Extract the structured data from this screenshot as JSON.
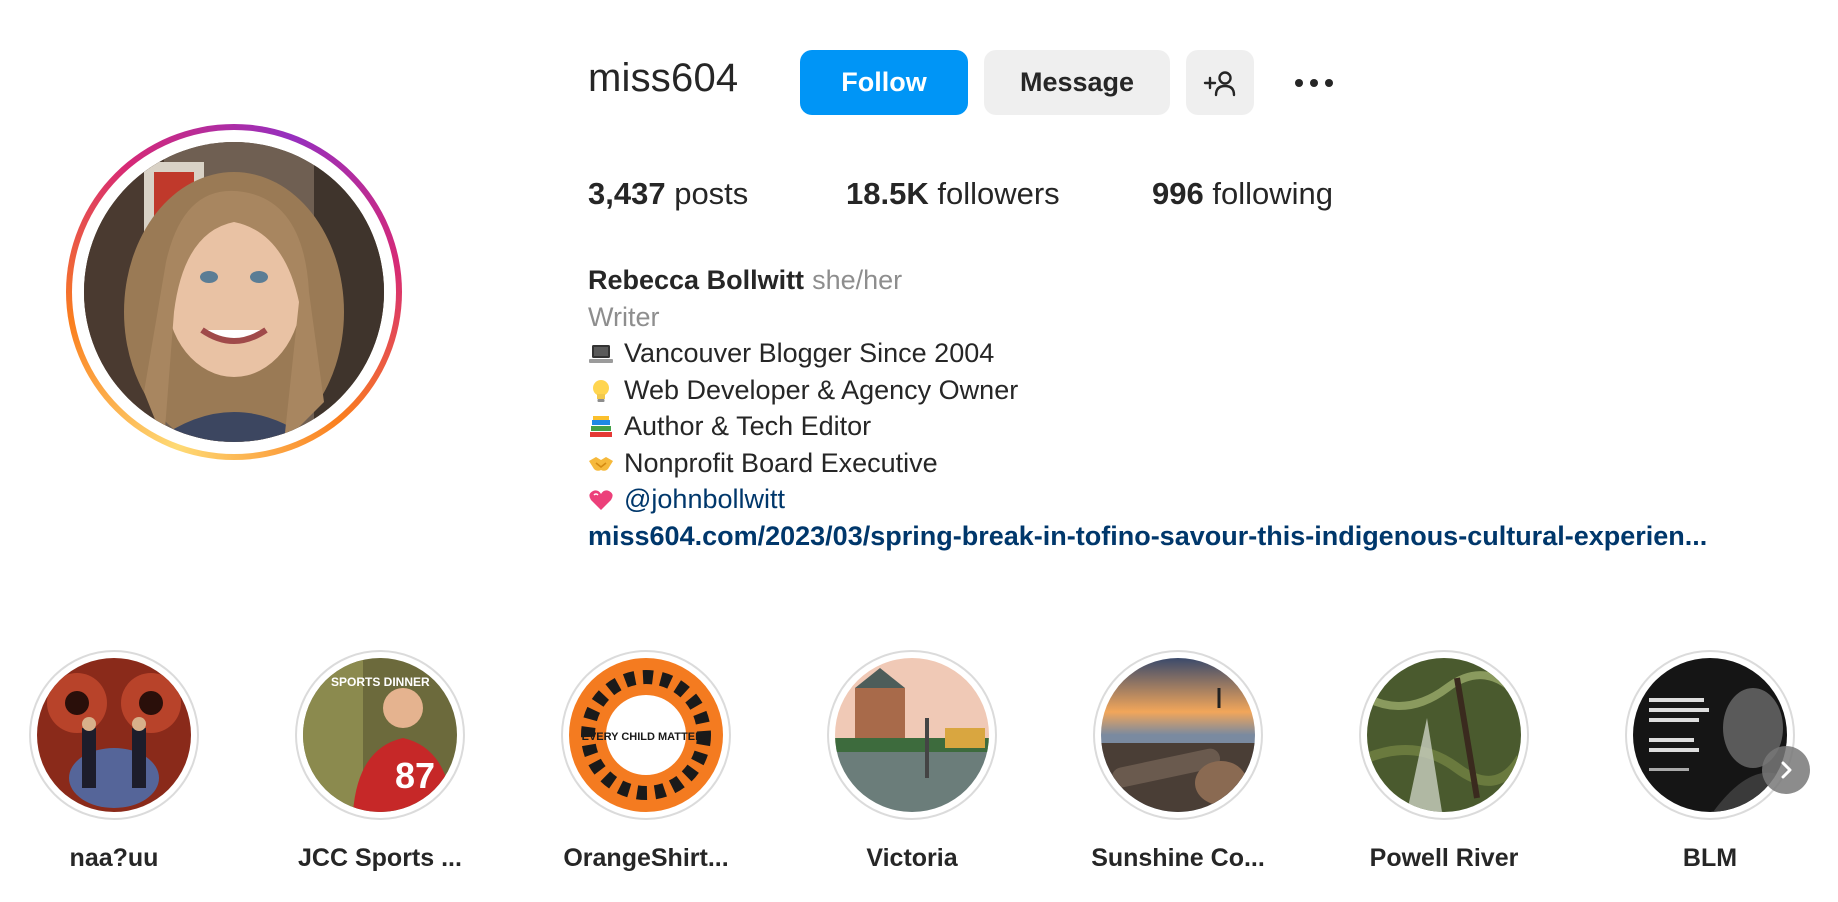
{
  "profile": {
    "username": "miss604",
    "follow_label": "Follow",
    "message_label": "Message",
    "stats": {
      "posts_count": "3,437",
      "posts_label": "posts",
      "followers_count": "18.5K",
      "followers_label": "followers",
      "following_count": "996",
      "following_label": "following"
    }
  },
  "bio": {
    "name": "Rebecca Bollwitt",
    "pronouns": "she/her",
    "category": "Writer",
    "lines": [
      {
        "icon": "laptop-icon",
        "text": "Vancouver Blogger Since 2004"
      },
      {
        "icon": "lightbulb-icon",
        "text": "Web Developer & Agency Owner"
      },
      {
        "icon": "books-icon",
        "text": "Author & Tech Editor"
      },
      {
        "icon": "handshake-icon",
        "text": "Nonprofit Board Executive"
      },
      {
        "icon": "heart-icon",
        "text": "@johnbollwitt"
      }
    ],
    "link": "miss604.com/2023/03/spring-break-in-tofino-savour-this-indigenous-cultural-experien..."
  },
  "highlights": [
    {
      "label": "naa?uu"
    },
    {
      "label": "JCC Sports ..."
    },
    {
      "label": "OrangeShirt..."
    },
    {
      "label": "Victoria"
    },
    {
      "label": "Sunshine Co..."
    },
    {
      "label": "Powell River"
    },
    {
      "label": "BLM"
    }
  ],
  "highlight_thumb_text": {
    "jcc_sports": "SPORTS DINNER",
    "jcc_jersey": "87",
    "orange_shirt": "EVERY CHILD MATTERS"
  },
  "colors": {
    "follow_button": "#0095f6",
    "secondary_button": "#efefef",
    "link": "#00376b",
    "muted_text": "#8e8e8e"
  }
}
